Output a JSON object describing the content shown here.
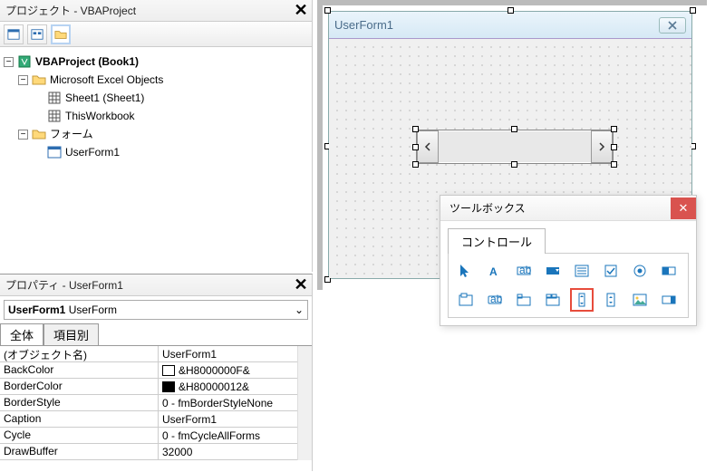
{
  "project_panel": {
    "title": "プロジェクト - VBAProject",
    "root": "VBAProject (Book1)",
    "folder_objects": "Microsoft Excel Objects",
    "sheet1": "Sheet1 (Sheet1)",
    "thisworkbook": "ThisWorkbook",
    "folder_forms": "フォーム",
    "userform": "UserForm1"
  },
  "properties_panel": {
    "title": "プロパティ - UserForm1",
    "object_name": "UserForm1",
    "object_type": "UserForm",
    "tab_all": "全体",
    "tab_cat": "項目別",
    "rows": [
      {
        "name": "(オブジェクト名)",
        "value": "UserForm1"
      },
      {
        "name": "BackColor",
        "value": "&H8000000F&",
        "swatch": "#ffffff"
      },
      {
        "name": "BorderColor",
        "value": "&H80000012&",
        "swatch": "#000000"
      },
      {
        "name": "BorderStyle",
        "value": "0 - fmBorderStyleNone"
      },
      {
        "name": "Caption",
        "value": "UserForm1"
      },
      {
        "name": "Cycle",
        "value": "0 - fmCycleAllForms"
      },
      {
        "name": "DrawBuffer",
        "value": "32000"
      }
    ]
  },
  "form": {
    "caption": "UserForm1"
  },
  "toolbox": {
    "title": "ツールボックス",
    "tab": "コントロール"
  }
}
